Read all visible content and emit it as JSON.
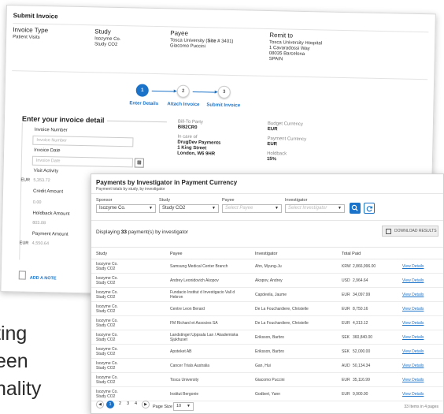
{
  "background_text": [
    "ting",
    "een",
    "nality"
  ],
  "invoice": {
    "title": "Submit Invoice",
    "invoice_type": {
      "label": "Invoice Type",
      "value": "Patient Visits"
    },
    "study": {
      "label": "Study",
      "line1": "Isozyme Co.",
      "line2": "Study CO2"
    },
    "payee": {
      "label": "Payee",
      "line1_pre": "Tosca University (",
      "line1_bold": "Site #",
      "line1_post": " 3401)",
      "line2": "Giacomo Puccini"
    },
    "remit_to": {
      "label": "Remit to",
      "lines": [
        "Tosca University Hospital",
        "1 Cavaradossi Way",
        "08035 Barcelona",
        "SPAIN"
      ]
    },
    "steps": [
      {
        "num": "1",
        "label": "Enter Details"
      },
      {
        "num": "2",
        "label": "Attach Invoice"
      },
      {
        "num": "3",
        "label": "Submit Invoice"
      }
    ],
    "section_title": "Enter your invoice detail",
    "fields": {
      "invoice_number": {
        "label": "Invoice Number",
        "placeholder": "Invoice Number"
      },
      "invoice_date": {
        "label": "Invoice Date",
        "placeholder": "Invoice Date"
      },
      "visit_activity": {
        "label": "Visit Activity",
        "currency": "EUR",
        "value": "5,353.72"
      },
      "credit_amount": {
        "label": "Credit Amount",
        "value": "0.00"
      },
      "holdback_amount": {
        "label": "Holdback Amount",
        "value": "803.08"
      },
      "payment_amount": {
        "label": "Payment Amount",
        "currency": "EUR",
        "value": "4,550.64"
      }
    },
    "add_note": "ADD A NOTE",
    "bill_to": {
      "label": "Bill-To Party",
      "value": "BI82CR0"
    },
    "in_care_of": {
      "label": "In care of",
      "lines": [
        "DrugDev Payments",
        "1 King Street",
        "London, W6 9HR"
      ]
    },
    "budget_currency": {
      "label": "Budget Currency",
      "value": "EUR"
    },
    "payment_currency": {
      "label": "Payment Currency",
      "value": "EUR"
    },
    "holdback": {
      "label": "Holdback",
      "value": "15%"
    }
  },
  "payments": {
    "title": "Payments by Investigator in Payment Currency",
    "subtitle": "Payment totals by study, by investigator",
    "filters": {
      "sponsor": {
        "label": "Sponsor",
        "value": "Isozyme Co."
      },
      "study": {
        "label": "Study",
        "value": "Study CO2"
      },
      "payee": {
        "label": "Payee",
        "placeholder": "Select Payee"
      },
      "investigator": {
        "label": "Investigator",
        "placeholder": "Select Investigator"
      }
    },
    "display_pre": "Displaying ",
    "display_count": "33",
    "display_post": " payment(s) by investigator",
    "download_label": "DOWNLOAD RESULTS",
    "columns": [
      "Study",
      "Payee",
      "Investigator",
      "Total Paid"
    ],
    "rows": [
      {
        "study1": "Isozyme Co.",
        "study2": "Study CO2",
        "payee1": "Samsung Medical Center Branch",
        "payee2": "",
        "investigator": "Ahn, Myung-Ju",
        "currency": "KRW",
        "amount": "2,866,996.00",
        "link": "View Details"
      },
      {
        "study1": "Isozyme Co.",
        "study2": "Study CO2",
        "payee1": "Andrey Leonidovich Akopov",
        "payee2": "",
        "investigator": "Akopov, Andrey",
        "currency": "USD",
        "amount": "2,964.64",
        "link": "View Details"
      },
      {
        "study1": "Isozyme Co.",
        "study2": "Study CO2",
        "payee1": "Fundacio Institut d Investigacio Vall d",
        "payee2": "Hebron",
        "investigator": "Capdevila, Jaume",
        "currency": "EUR",
        "amount": "34,097.99",
        "link": "View Details"
      },
      {
        "study1": "Isozyme Co.",
        "study2": "Study CO2",
        "payee1": "Centre Leon Berard",
        "payee2": "",
        "investigator": "De La Fouchardiere, Christelle",
        "currency": "EUR",
        "amount": "8,750.16",
        "link": "View Details"
      },
      {
        "study1": "Isozyme Co.",
        "study2": "Study CO2",
        "payee1": "FM Richard et Associes SA",
        "payee2": "",
        "investigator": "De La Fouchardiere, Christelle",
        "currency": "EUR",
        "amount": "4,313.12",
        "link": "View Details"
      },
      {
        "study1": "Isozyme Co.",
        "study2": "Study CO2",
        "payee1": "Landstinget Uppsala Lan / Akademiska",
        "payee2": "Sjukhuset",
        "investigator": "Eriksson, Barbro",
        "currency": "SEK",
        "amount": "360,840.00",
        "link": "View Details"
      },
      {
        "study1": "Isozyme Co.",
        "study2": "Study CO2",
        "payee1": "Apoteket AB",
        "payee2": "",
        "investigator": "Eriksson, Barbro",
        "currency": "SEK",
        "amount": "52,000.00",
        "link": "View Details"
      },
      {
        "study1": "Isozyme Co.",
        "study2": "Study CO2",
        "payee1": "Cancer Trials Australia",
        "payee2": "",
        "investigator": "Gan, Hui",
        "currency": "AUD",
        "amount": "50,134.34",
        "link": "View Details"
      },
      {
        "study1": "Isozyme Co.",
        "study2": "Study CO2",
        "payee1": "Tosca University",
        "payee2": "",
        "investigator": "Giacomo Puccini",
        "currency": "EUR",
        "amount": "35,116.99",
        "link": "View Details"
      },
      {
        "study1": "Isozyme Co.",
        "study2": "Study CO2",
        "payee1": "Institut Bergonie",
        "payee2": "",
        "investigator": "Godbert, Yann",
        "currency": "EUR",
        "amount": "9,900.00",
        "link": "View Details"
      }
    ],
    "pager": {
      "current": "1",
      "pages": [
        "2",
        "3",
        "4"
      ],
      "page_size_label": "Page Size",
      "page_size": "10",
      "items_info": "33 Items in 4 pages"
    },
    "accent": "#1a73c9"
  }
}
